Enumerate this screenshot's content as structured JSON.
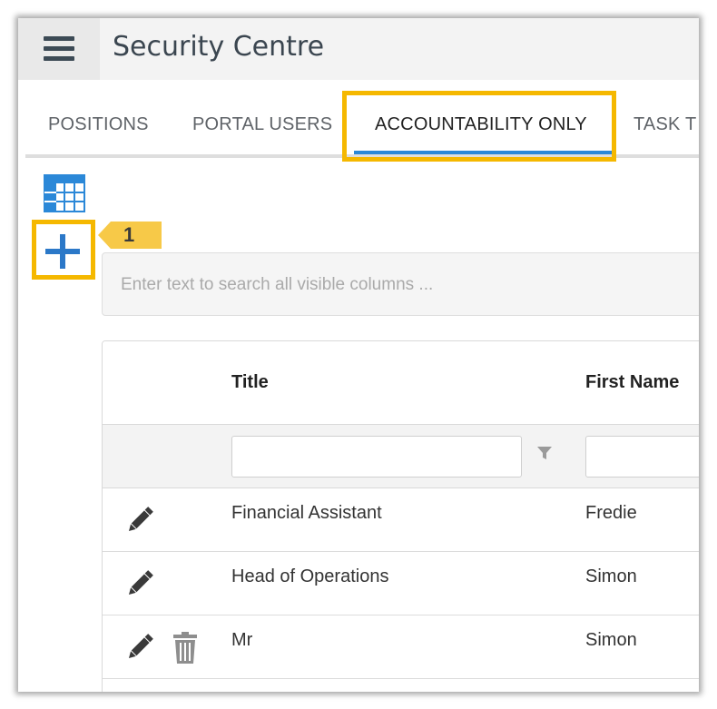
{
  "header": {
    "title": "Security Centre",
    "menu_icon": "hamburger-menu-icon"
  },
  "tabs": [
    {
      "label": "POSITIONS",
      "active": false
    },
    {
      "label": "PORTAL USERS",
      "active": false
    },
    {
      "label": "ACCOUNTABILITY ONLY",
      "active": true
    },
    {
      "label": "TASK T",
      "active": false
    }
  ],
  "toolbar": {
    "grid_icon": "table-grid-icon",
    "add_icon": "plus-icon"
  },
  "annotation": {
    "step": "1",
    "highlight_color": "#f5b800"
  },
  "search": {
    "placeholder": "Enter text to search all visible columns ...",
    "value": ""
  },
  "table": {
    "columns": [
      "",
      "Title",
      "First Name"
    ],
    "rows": [
      {
        "title": "Financial Assistant",
        "first_name": "Fredie",
        "actions": [
          "edit"
        ]
      },
      {
        "title": "Head of Operations",
        "first_name": "Simon",
        "actions": [
          "edit"
        ]
      },
      {
        "title": "Mr",
        "first_name": "Simon",
        "actions": [
          "edit",
          "delete"
        ]
      }
    ]
  },
  "colors": {
    "accent": "#2b88d8",
    "highlight": "#f5b800",
    "topbar": "#f3f3f3"
  }
}
